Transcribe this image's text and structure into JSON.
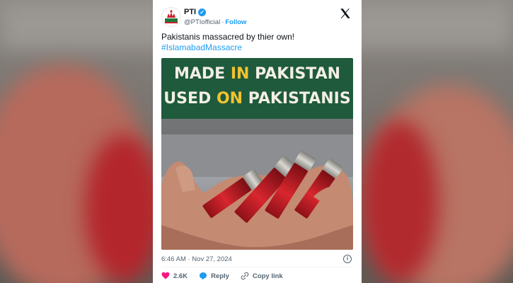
{
  "post": {
    "display_name": "PTI",
    "handle": "@PTIofficial",
    "separator": "·",
    "follow_label": "Follow",
    "text": "Pakistanis massacred by thier own!",
    "hashtag": "#IslamabadMassacre",
    "timestamp": "6:46 AM · Nov 27, 2024",
    "info_glyph": "i"
  },
  "media": {
    "line1": {
      "part1": "MADE ",
      "highlight": "IN",
      "part2": " PAKISTAN"
    },
    "line2": {
      "part1": "USED ",
      "highlight": "ON",
      "part2": " PAKISTANIS"
    },
    "colors": {
      "banner": "#1f5a3c",
      "highlight": "#f2c230",
      "text": "#f3efe4",
      "shell": "#c8202a"
    }
  },
  "actions": {
    "likes": "2.6K",
    "reply_label": "Reply",
    "copy_label": "Copy link"
  },
  "colors": {
    "accent": "#1d9bf0",
    "like": "#f91880",
    "muted": "#536471"
  }
}
